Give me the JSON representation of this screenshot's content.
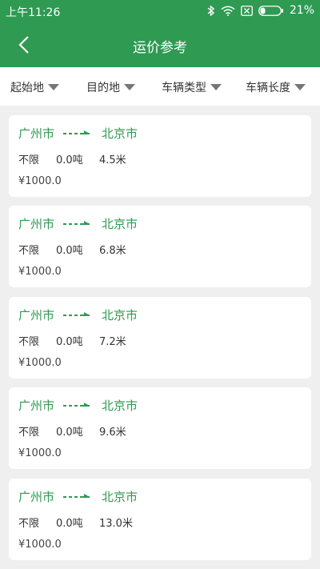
{
  "status_bar": {
    "time": "上午11:26",
    "battery": "21%"
  },
  "header": {
    "title": "运价参考"
  },
  "filters": [
    {
      "label": "起始地"
    },
    {
      "label": "目的地"
    },
    {
      "label": "车辆类型"
    },
    {
      "label": "车辆长度"
    }
  ],
  "listings": [
    {
      "origin": "广州市",
      "destination": "北京市",
      "type": "不限",
      "weight": "0.0吨",
      "length": "4.5米",
      "price": "¥1000.0"
    },
    {
      "origin": "广州市",
      "destination": "北京市",
      "type": "不限",
      "weight": "0.0吨",
      "length": "6.8米",
      "price": "¥1000.0"
    },
    {
      "origin": "广州市",
      "destination": "北京市",
      "type": "不限",
      "weight": "0.0吨",
      "length": "7.2米",
      "price": "¥1000.0"
    },
    {
      "origin": "广州市",
      "destination": "北京市",
      "type": "不限",
      "weight": "0.0吨",
      "length": "9.6米",
      "price": "¥1000.0"
    },
    {
      "origin": "广州市",
      "destination": "北京市",
      "type": "不限",
      "weight": "0.0吨",
      "length": "13.0米",
      "price": "¥1000.0"
    }
  ],
  "colors": {
    "primary": "#2e9a52",
    "background": "#efefef"
  }
}
